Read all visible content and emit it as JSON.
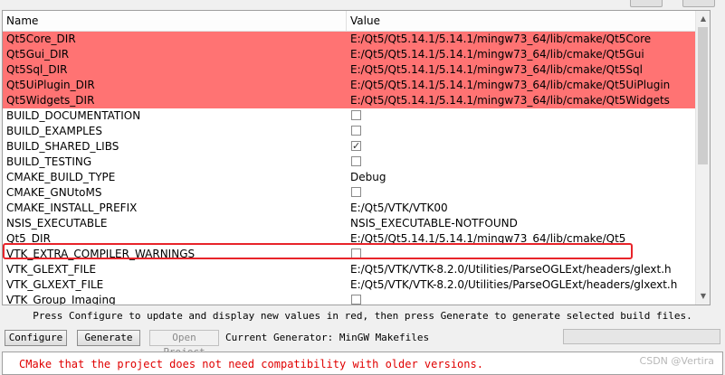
{
  "table": {
    "columns": {
      "name": "Name",
      "value": "Value"
    },
    "rows": [
      {
        "name": "Qt5Core_DIR",
        "value": "E:/Qt5/Qt5.14.1/5.14.1/mingw73_64/lib/cmake/Qt5Core",
        "new": true
      },
      {
        "name": "Qt5Gui_DIR",
        "value": "E:/Qt5/Qt5.14.1/5.14.1/mingw73_64/lib/cmake/Qt5Gui",
        "new": true
      },
      {
        "name": "Qt5Sql_DIR",
        "value": "E:/Qt5/Qt5.14.1/5.14.1/mingw73_64/lib/cmake/Qt5Sql",
        "new": true
      },
      {
        "name": "Qt5UiPlugin_DIR",
        "value": "E:/Qt5/Qt5.14.1/5.14.1/mingw73_64/lib/cmake/Qt5UiPlugin",
        "new": true
      },
      {
        "name": "Qt5Widgets_DIR",
        "value": "E:/Qt5/Qt5.14.1/5.14.1/mingw73_64/lib/cmake/Qt5Widgets",
        "new": true
      },
      {
        "name": "BUILD_DOCUMENTATION",
        "value": "",
        "checkbox": true,
        "checked": false
      },
      {
        "name": "BUILD_EXAMPLES",
        "value": "",
        "checkbox": true,
        "checked": false
      },
      {
        "name": "BUILD_SHARED_LIBS",
        "value": "",
        "checkbox": true,
        "checked": true
      },
      {
        "name": "BUILD_TESTING",
        "value": "",
        "checkbox": true,
        "checked": false
      },
      {
        "name": "CMAKE_BUILD_TYPE",
        "value": "Debug"
      },
      {
        "name": "CMAKE_GNUtoMS",
        "value": "",
        "checkbox": true,
        "checked": false
      },
      {
        "name": "CMAKE_INSTALL_PREFIX",
        "value": "E:/Qt5/VTK/VTK00"
      },
      {
        "name": "NSIS_EXECUTABLE",
        "value": "NSIS_EXECUTABLE-NOTFOUND"
      },
      {
        "name": "Qt5_DIR",
        "value": "E:/Qt5/Qt5.14.1/5.14.1/mingw73_64/lib/cmake/Qt5"
      },
      {
        "name": "VTK_EXTRA_COMPILER_WARNINGS",
        "value": "",
        "checkbox": true,
        "checked": false
      },
      {
        "name": "VTK_GLEXT_FILE",
        "value": "E:/Qt5/VTK/VTK-8.2.0/Utilities/ParseOGLExt/headers/glext.h"
      },
      {
        "name": "VTK_GLXEXT_FILE",
        "value": "E:/Qt5/VTK/VTK-8.2.0/Utilities/ParseOGLExt/headers/glxext.h"
      },
      {
        "name": "VTK_Group_Imaging",
        "value": "",
        "checkbox": true,
        "checked": false
      }
    ]
  },
  "hint": "Press Configure to update and display new values in red, then press Generate to generate selected build files.",
  "buttons": {
    "configure": "Configure",
    "generate": "Generate",
    "open_project": "Open Project"
  },
  "generator": "Current Generator: MinGW Makefiles",
  "log": {
    "line": "CMake that the project does not need compatibility with older versions."
  },
  "watermark": "CSDN @Vertira",
  "colors": {
    "new_entry": "#ff7373",
    "highlight": "#e8242a",
    "log_text": "#e00000"
  }
}
